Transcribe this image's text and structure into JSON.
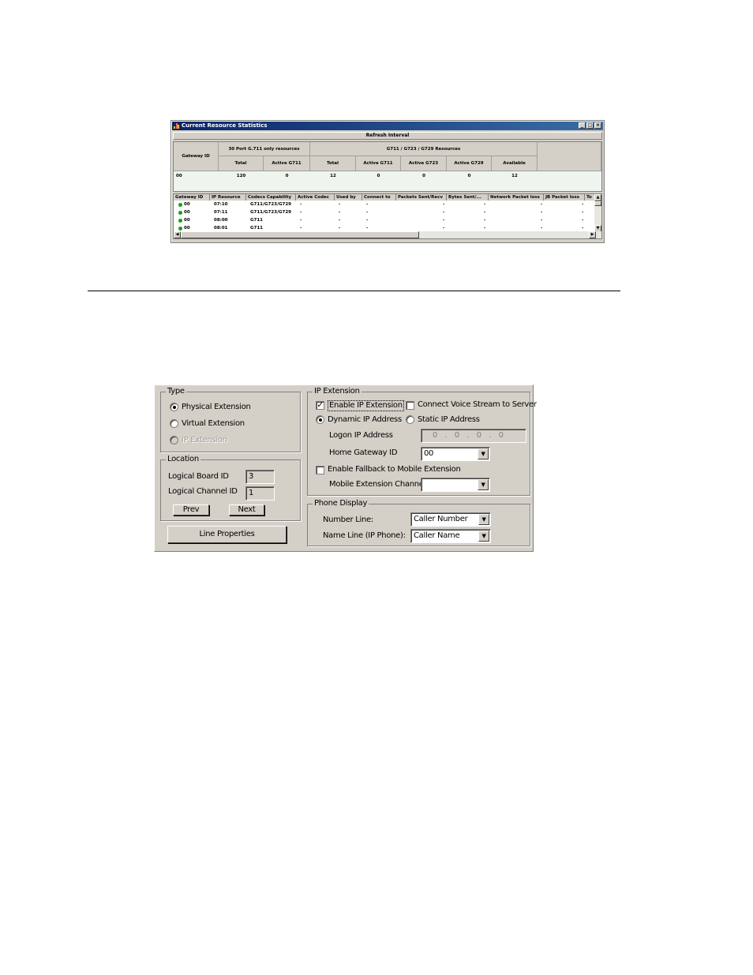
{
  "stats_window": {
    "title": "Current Resource Statistics",
    "refresh_label": "Refresh Interval",
    "summary": {
      "gateway_id_header": "Gateway ID",
      "group_30port": "30 Port G.711 only resources",
      "group_mixed": "G711 / G723 / G729 Resources",
      "sub_total_1": "Total",
      "sub_active_g711_1": "Active G711",
      "sub_total_2": "Total",
      "sub_active_g711_2": "Active G711",
      "sub_active_g723": "Active G723",
      "sub_active_g729": "Active G729",
      "sub_available": "Available",
      "row": {
        "gateway_id": "00",
        "total_1": "120",
        "active_g711_1": "0",
        "total_2": "12",
        "active_g711_2": "0",
        "active_g723": "0",
        "active_g729": "0",
        "available": "12"
      }
    },
    "list": {
      "columns": [
        "Gateway ID",
        "IP Resource",
        "Codecs Capability",
        "Active Codec",
        "Used by",
        "Connect to",
        "Packets Sent/Recv",
        "Bytes Sent/...",
        "Network Packet loss",
        "JB Packet loss",
        "To"
      ],
      "rows": [
        {
          "gateway": "00",
          "resource": "07:10",
          "codecs": "G711/G723/G729",
          "active": "-",
          "used_by": "-",
          "connect": "-",
          "packets": "-",
          "bytes": "-",
          "net_loss": "-",
          "jb_loss": "-"
        },
        {
          "gateway": "00",
          "resource": "07:11",
          "codecs": "G711/G723/G729",
          "active": "-",
          "used_by": "-",
          "connect": "-",
          "packets": "-",
          "bytes": "-",
          "net_loss": "-",
          "jb_loss": "-"
        },
        {
          "gateway": "00",
          "resource": "08:00",
          "codecs": "G711",
          "active": "-",
          "used_by": "-",
          "connect": "-",
          "packets": "-",
          "bytes": "-",
          "net_loss": "-",
          "jb_loss": "-"
        },
        {
          "gateway": "00",
          "resource": "08:01",
          "codecs": "G711",
          "active": "-",
          "used_by": "-",
          "connect": "-",
          "packets": "-",
          "bytes": "-",
          "net_loss": "-",
          "jb_loss": "-"
        }
      ],
      "status_color": "#18a018"
    }
  },
  "extension_dialog": {
    "type_group": {
      "legend": "Type",
      "physical": "Physical Extension",
      "virtual": "Virtual Extension",
      "ip": "IP Extension",
      "selected": "physical"
    },
    "location_group": {
      "legend": "Location",
      "board_label": "Logical Board ID",
      "board_value": "3",
      "channel_label": "Logical Channel ID",
      "channel_value": "1",
      "prev": "Prev",
      "next": "Next"
    },
    "line_properties": "Line Properties",
    "ip_group": {
      "legend": "IP Extension",
      "enable_ip": "Enable IP Extension",
      "enable_ip_checked": true,
      "connect_voice": "Connect Voice Stream to Server",
      "connect_voice_checked": false,
      "dynamic_ip": "Dynamic IP Address",
      "static_ip": "Static IP Address",
      "ip_mode": "dynamic",
      "logon_ip_label": "Logon IP Address",
      "logon_ip_value": "0 . 0 . 0 . 0",
      "home_gateway_label": "Home Gateway ID",
      "home_gateway_value": "00",
      "fallback": "Enable Fallback to Mobile Extension",
      "fallback_checked": false,
      "mobile_channel_label": "Mobile Extension Channel",
      "mobile_channel_value": ""
    },
    "phone_display": {
      "legend": "Phone Display",
      "number_line_label": "Number Line:",
      "number_line_value": "Caller Number",
      "name_line_label": "Name Line (IP Phone):",
      "name_line_value": "Caller Name"
    }
  }
}
